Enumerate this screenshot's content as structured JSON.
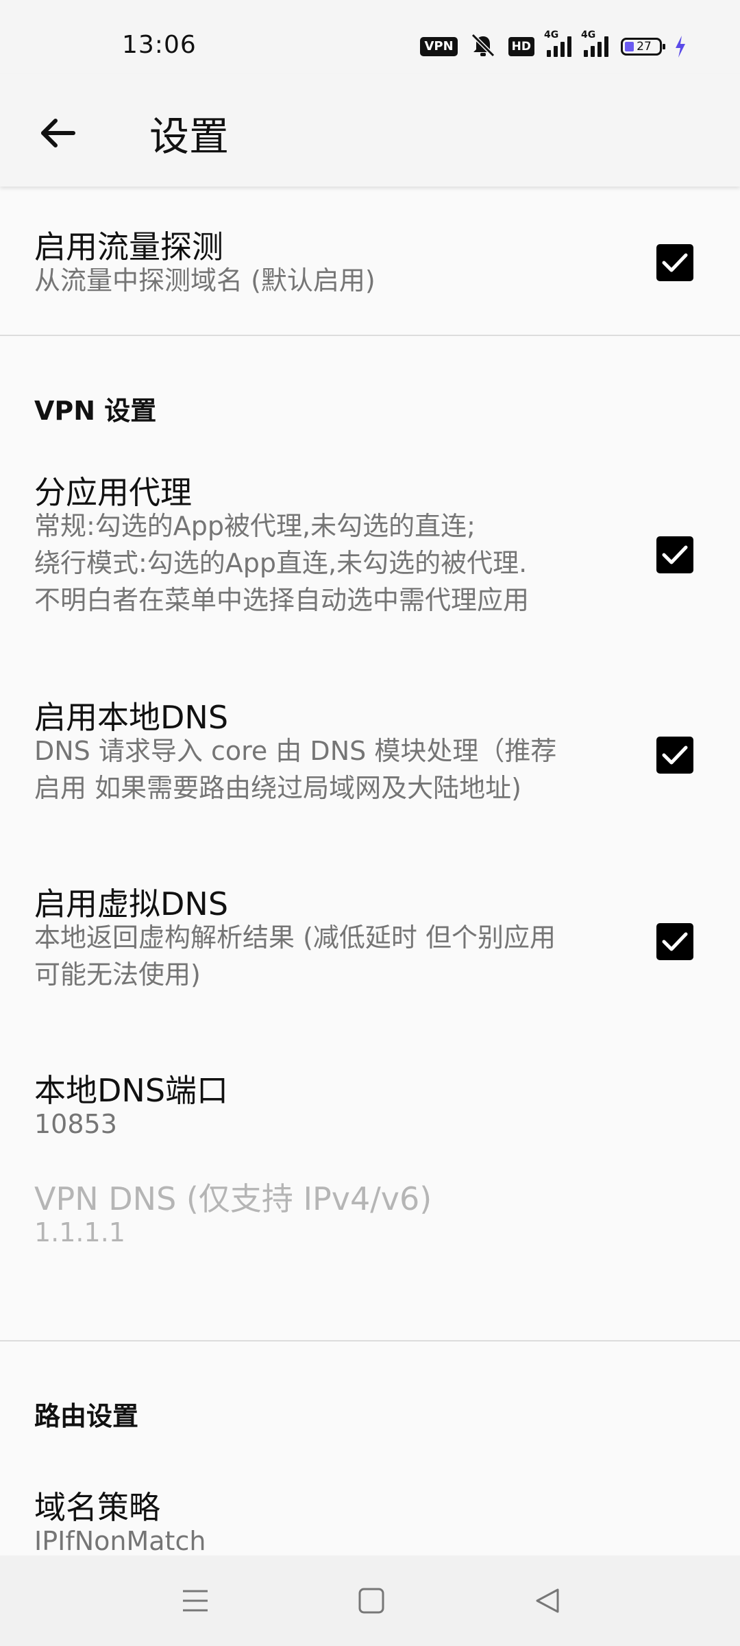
{
  "status_bar": {
    "time": "13:06",
    "vpn_badge": "VPN",
    "hd_badge": "HD",
    "signal1_label": "4G",
    "signal2_label": "4G",
    "battery_level": "27",
    "icons": [
      "vpn-icon",
      "mute-bell-icon",
      "hd-icon",
      "signal-icon",
      "signal-icon",
      "battery-icon",
      "charging-bolt-icon"
    ]
  },
  "toolbar": {
    "back_icon": "arrow-left-icon",
    "title": "设置"
  },
  "prefs": {
    "sniffing": {
      "title": "启用流量探测",
      "summary": "从流量中探测域名 (默认启用)",
      "checked": true
    },
    "vpn_header": "VPN 设置",
    "per_app_proxy": {
      "title": "分应用代理",
      "summary": "常规:勾选的App被代理,未勾选的直连;\n绕行模式:勾选的App直连,未勾选的被代理.\n不明白者在菜单中选择自动选中需代理应用",
      "checked": true
    },
    "local_dns": {
      "title": "启用本地DNS",
      "summary": "DNS 请求导入 core 由 DNS 模块处理（推荐\n启用 如果需要路由绕过局域网及大陆地址)",
      "checked": true
    },
    "fake_dns": {
      "title": "启用虚拟DNS",
      "summary": "本地返回虚构解析结果 (减低延时 但个别应用\n可能无法使用)",
      "checked": true
    },
    "local_dns_port": {
      "title": "本地DNS端口",
      "value": "10853"
    },
    "vpn_dns": {
      "title": "VPN DNS (仅支持 IPv4/v6)",
      "value": "1.1.1.1",
      "enabled": false
    },
    "routing_header": "路由设置",
    "domain_strategy": {
      "title": "域名策略",
      "value": "IPIfNonMatch"
    }
  },
  "nav_bar": {
    "icons": [
      "menu-icon",
      "home-square-icon",
      "back-triangle-icon"
    ]
  },
  "colors": {
    "background": "#fafafa",
    "summary_text": "#757575",
    "disabled_text": "#b5b5b5",
    "checkbox": "#000000",
    "battery_fill": "#6a5af0"
  }
}
